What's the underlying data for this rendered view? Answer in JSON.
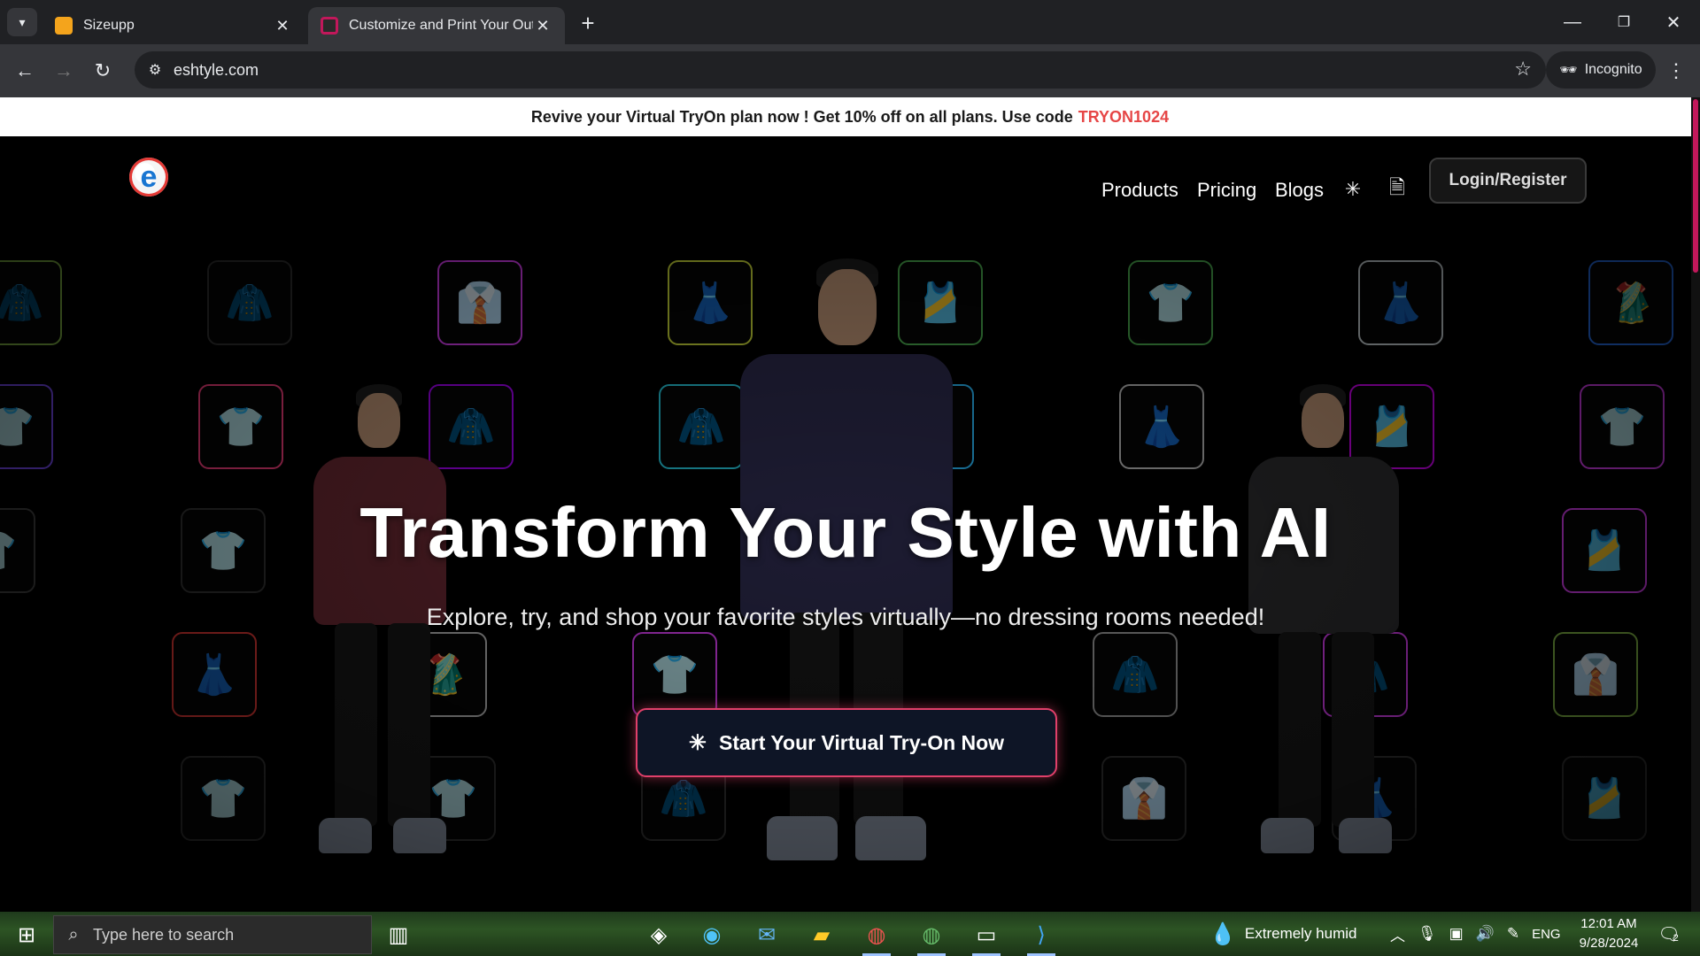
{
  "browser": {
    "tabs": [
      {
        "title": "Sizeupp",
        "favicon_color": "#f4a41c"
      },
      {
        "title": "Customize and Print Your Outfit",
        "favicon_color": "#c2185b"
      }
    ],
    "url": "eshtyle.com",
    "incognito_label": "Incognito"
  },
  "promo": {
    "text": "Revive your Virtual TryOn plan now ! Get 10% off on all plans. Use code",
    "code": "TRYON1024",
    "code_color": "#e64646"
  },
  "site": {
    "nav": {
      "products": "Products",
      "pricing": "Pricing",
      "blogs": "Blogs",
      "login": "Login/Register"
    },
    "hero": {
      "title": "Transform Your Style with AI",
      "subtitle": "Explore, try, and shop your favorite styles virtually—no dressing rooms needed!",
      "cta": "Start Your Virtual Try-On Now"
    },
    "accent_color": "#e0406a"
  },
  "taskbar": {
    "search_placeholder": "Type here to search",
    "weather": "Extremely humid",
    "language": "ENG",
    "time": "12:01 AM",
    "date": "9/28/2024",
    "notification_count": "2"
  }
}
